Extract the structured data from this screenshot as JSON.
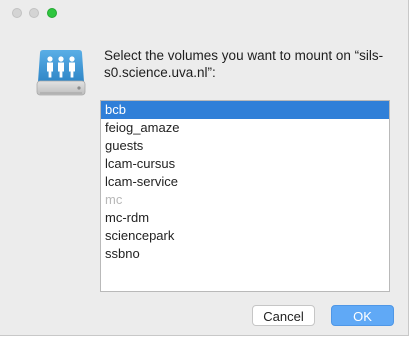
{
  "dialog": {
    "prompt": "Select the volumes you want to mount on “sils-s0.science.uva.nl”:",
    "icon": "file-server-icon"
  },
  "volumes": [
    {
      "label": "bcb",
      "state": "selected"
    },
    {
      "label": "feiog_amaze",
      "state": "normal"
    },
    {
      "label": "guests",
      "state": "normal"
    },
    {
      "label": "lcam-cursus",
      "state": "normal"
    },
    {
      "label": "lcam-service",
      "state": "normal"
    },
    {
      "label": "mc",
      "state": "disabled"
    },
    {
      "label": "mc-rdm",
      "state": "normal"
    },
    {
      "label": "sciencepark",
      "state": "normal"
    },
    {
      "label": "ssbno",
      "state": "normal"
    }
  ],
  "buttons": {
    "cancel_label": "Cancel",
    "ok_label": "OK"
  },
  "colors": {
    "selection": "#2f7fd8",
    "default_button": "#60a9f6",
    "zoom_button": "#2ec63f"
  }
}
